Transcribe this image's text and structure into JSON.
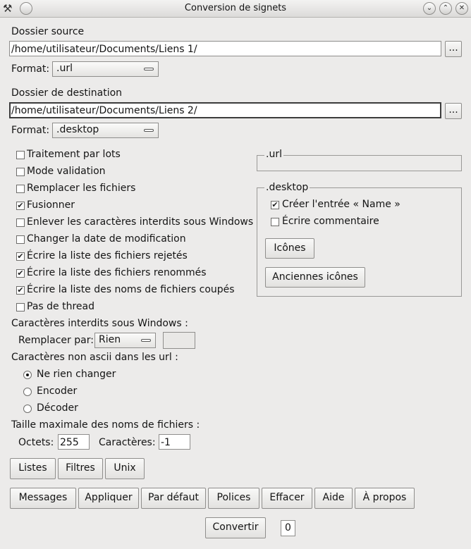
{
  "window": {
    "title": "Conversion de signets"
  },
  "source": {
    "label": "Dossier source",
    "path": "/home/utilisateur/Documents/Liens 1/",
    "browse": "...",
    "format_label": "Format:",
    "format_value": ".url"
  },
  "destination": {
    "label": "Dossier de destination",
    "path": "/home/utilisateur/Documents/Liens 2/",
    "browse": "...",
    "format_label": "Format:",
    "format_value": ".desktop"
  },
  "options": [
    {
      "label": "Traitement par lots",
      "checked": false
    },
    {
      "label": "Mode validation",
      "checked": false
    },
    {
      "label": "Remplacer les fichiers",
      "checked": false
    },
    {
      "label": "Fusionner",
      "checked": true
    },
    {
      "label": "Enlever les caractères interdits sous Windows",
      "checked": false
    },
    {
      "label": "Changer la date de modification",
      "checked": false
    },
    {
      "label": "Écrire la liste des fichiers rejetés",
      "checked": true
    },
    {
      "label": "Écrire la liste des fichiers renommés",
      "checked": true
    },
    {
      "label": "Écrire la liste des noms de fichiers coupés",
      "checked": true
    },
    {
      "label": "Pas de thread",
      "checked": false
    }
  ],
  "url_group": {
    "title": ".url"
  },
  "desktop_group": {
    "title": ".desktop",
    "options": [
      {
        "label": "Créer l'entrée « Name »",
        "checked": true
      },
      {
        "label": "Écrire commentaire",
        "checked": false
      }
    ],
    "icons_button": "Icônes",
    "old_icons_button": "Anciennes icônes"
  },
  "forbidden": {
    "label": "Caractères interdits sous Windows :",
    "replace_label": "Remplacer par:",
    "replace_value": "Rien",
    "custom_value": ""
  },
  "non_ascii": {
    "label": "Caractères non ascii dans les url :",
    "options": [
      {
        "label": "Ne rien changer",
        "selected": true
      },
      {
        "label": "Encoder",
        "selected": false
      },
      {
        "label": "Décoder",
        "selected": false
      }
    ]
  },
  "max_size": {
    "label": "Taille maximale des noms de fichiers :",
    "bytes_label": "Octets:",
    "bytes_value": "255",
    "chars_label": "Caractères:",
    "chars_value": "-1"
  },
  "tabs_row": [
    "Listes",
    "Filtres",
    "Unix"
  ],
  "actions_row": [
    "Messages",
    "Appliquer",
    "Par défaut",
    "Polices",
    "Effacer",
    "Aide",
    "À propos"
  ],
  "convert": {
    "label": "Convertir",
    "count": "0"
  },
  "icons": {
    "window_menu": "tools-icon",
    "minimize": "chevron-down-icon",
    "maximize": "chevron-up-icon",
    "close": "close-icon"
  }
}
